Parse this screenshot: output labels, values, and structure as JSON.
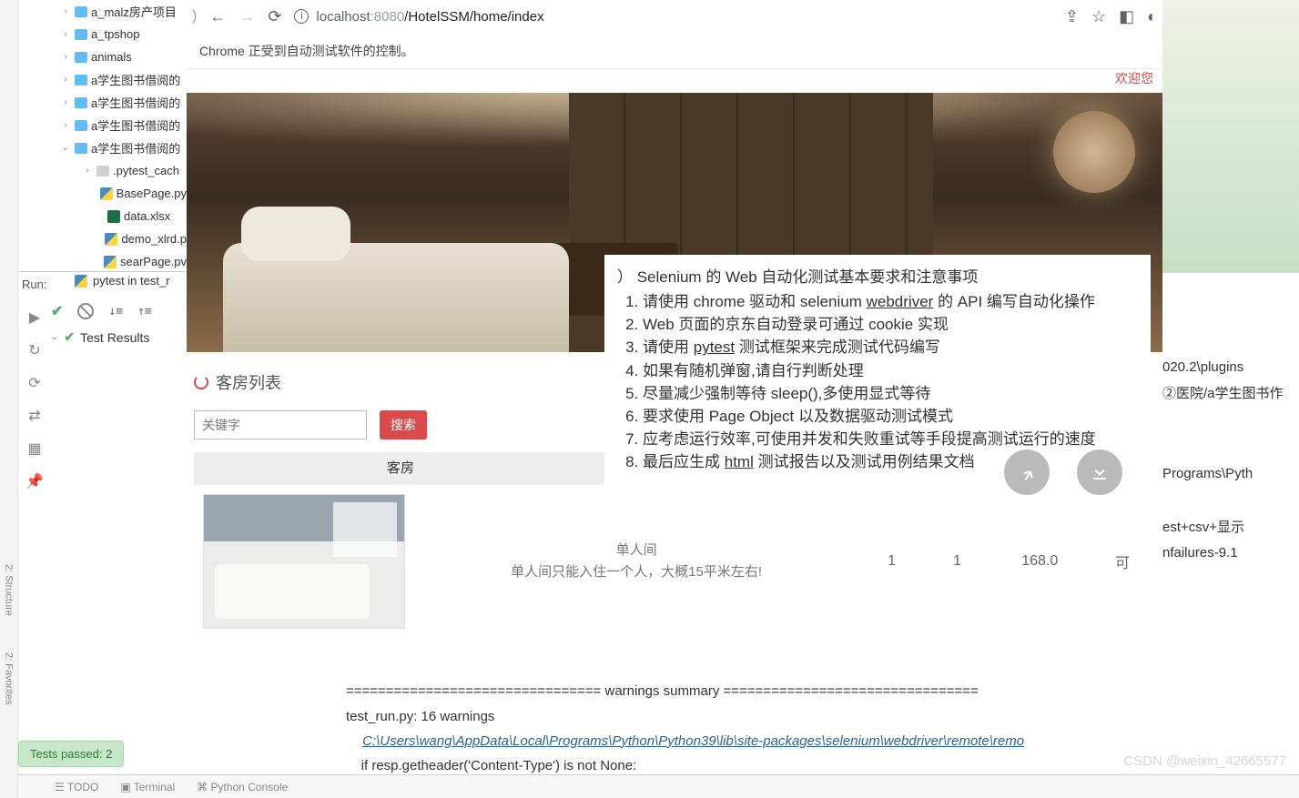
{
  "project_tree": {
    "items": [
      {
        "chev": "›",
        "indent": 46,
        "icon": "folder",
        "name": "a_malz房产项目"
      },
      {
        "chev": "›",
        "indent": 46,
        "icon": "folder",
        "name": "a_tpshop"
      },
      {
        "chev": "›",
        "indent": 46,
        "icon": "folder",
        "name": "animals"
      },
      {
        "chev": "›",
        "indent": 46,
        "icon": "folder",
        "name": "a学生图书借阅的"
      },
      {
        "chev": "›",
        "indent": 46,
        "icon": "folder",
        "name": "a学生图书借阅的"
      },
      {
        "chev": "›",
        "indent": 46,
        "icon": "folder",
        "name": "a学生图书借阅的"
      },
      {
        "chev": "⌄",
        "indent": 46,
        "icon": "folder",
        "name": "a学生图书借阅的"
      },
      {
        "chev": "›",
        "indent": 70,
        "icon": "folder-gray",
        "name": ".pytest_cach"
      },
      {
        "chev": "",
        "indent": 82,
        "icon": "py",
        "name": "BasePage.py"
      },
      {
        "chev": "",
        "indent": 82,
        "icon": "xlsx",
        "name": "data.xlsx"
      },
      {
        "chev": "",
        "indent": 82,
        "icon": "py",
        "name": "demo_xlrd.p"
      },
      {
        "chev": "",
        "indent": 82,
        "icon": "py",
        "name": "searPage.pv"
      }
    ]
  },
  "run": {
    "label": "Run:",
    "tab": "pytest in test_r"
  },
  "test_results": {
    "label": "Test Results"
  },
  "browser": {
    "url_host": "localhost",
    "url_port": ":8080",
    "url_path": "/HotelSSM/home/index",
    "automation_msg": "Chrome 正受到自动测试软件的控制。",
    "welcome": "欢迎您"
  },
  "page": {
    "room_list_title": "客房列表",
    "keyword_placeholder": "关键字",
    "search_btn": "搜索",
    "rooms_header": "客房",
    "room": {
      "type": "单人间",
      "desc": "单人间只能入住一个人，大概15平米左右!",
      "col1": "1",
      "col2": "1",
      "col3": "168.0",
      "col4": "可"
    }
  },
  "overlay": {
    "title": "）  Selenium 的 Web 自动化测试基本要求和注意事项",
    "items": [
      "请使用 chrome 驱动和 selenium <u>webdriver</u>  的 API 编写自动化操作",
      "Web 页面的京东自动登录可通过 cookie 实现",
      "请使用 <u>pytest</u> 测试框架来完成测试代码编写",
      "如果有随机弹窗,请自行判断处理",
      "尽量减少强制等待 sleep(),多使用显式等待",
      "要求使用 Page Object 以及数据驱动测试模式",
      "应考虑运行效率,可使用并发和失败重试等手段提高测试运行的速度",
      "最后应生成 <u>html</u> 测试报告以及测试用例结果文档"
    ]
  },
  "right_text": {
    "l1": "020.2\\plugins",
    "l2": "②医院/a学生图书作",
    "l3": "Programs\\Pyth",
    "l4": "est+csv+显示",
    "l5": "nfailures-9.1"
  },
  "console": {
    "l1": "================================ warnings summary ================================",
    "l2": "test_run.py: 16 warnings",
    "l3": "C:\\Users\\wang\\AppData\\Local\\Programs\\Python\\Python39\\lib\\site-packages\\selenium\\webdriver\\remote\\remo",
    "l4": "    if resp.getheader('Content-Type') is not None:"
  },
  "tests_badge": "Tests passed: 2",
  "watermark": "CSDN @weixin_42665577",
  "sidebar": {
    "structure": "2: Structure",
    "favorites": "2: Favorites"
  },
  "bottom": {
    "todo": "TODO",
    "terminal": "Terminal",
    "pyconsole": "Python Console"
  }
}
